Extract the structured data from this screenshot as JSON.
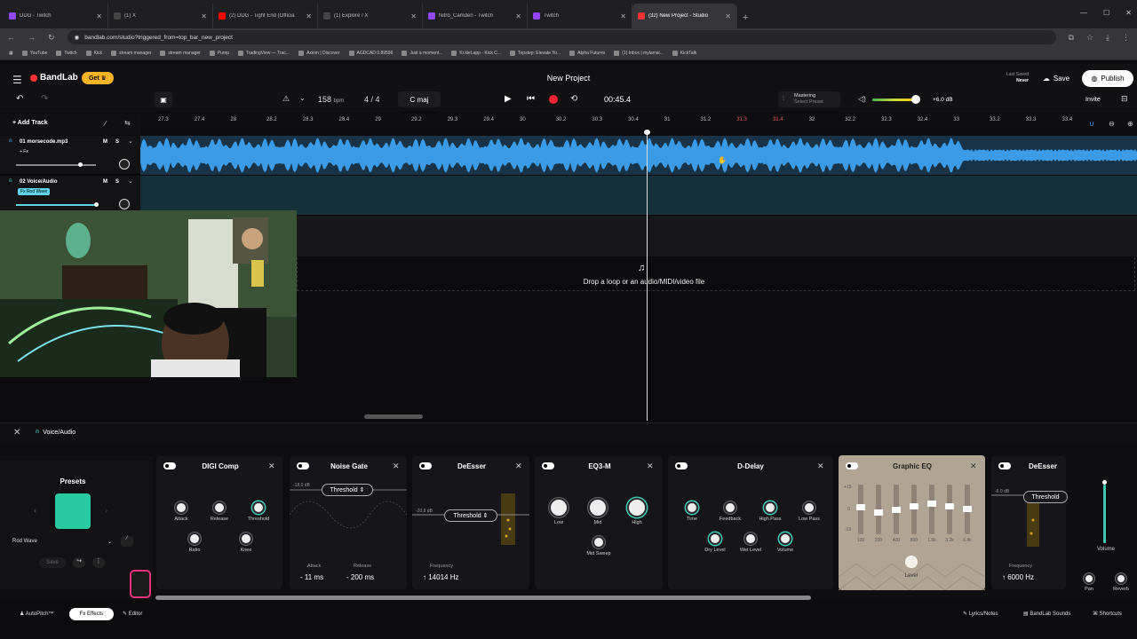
{
  "browser": {
    "tabs": [
      {
        "label": "DDG - Twitch",
        "color": "#9146ff"
      },
      {
        "label": "(1) X",
        "color": "#444444"
      },
      {
        "label": "(2) DDG - Tight End (Officia",
        "color": "#ff0000"
      },
      {
        "label": "(1) Explore / X",
        "color": "#444444"
      },
      {
        "label": "Nitro_Camden - Twitch",
        "color": "#9146ff"
      },
      {
        "label": "Twitch",
        "color": "#9146ff"
      },
      {
        "label": "(32) New Project - Studio",
        "color": "#f33333"
      }
    ],
    "url": "bandlab.com/studio?triggered_from=top_bar_new_project",
    "bookmarks": [
      "YouTube",
      "Twitch",
      "Kick",
      "stream manager",
      "stream manager",
      "Pump",
      "TradingView — Trac...",
      "Axiom | Discover",
      "AGDCAD 0.89596",
      "Just a moment...",
      "Kr.kleLapp - Kick C...",
      "Topstep: Elevate Yo...",
      "Alpha Futures",
      "(1) Inbox | mylamai...",
      "KickTalk"
    ]
  },
  "app": {
    "logo": "BandLab",
    "get_label": "Get",
    "project_title": "New Project",
    "last_saved_label": "Last Saved",
    "last_saved_value": "Never",
    "save_label": "Save",
    "publish_label": "Publish",
    "invite_label": "Invite"
  },
  "transport": {
    "bpm_value": "158",
    "bpm_unit": "bpm",
    "time_sig": "4 / 4",
    "key": "C maj",
    "time": "00:45.4",
    "mastering_label": "Mastering",
    "mastering_preset": "Select Preset",
    "gain": "+6.0 dB"
  },
  "ruler": [
    "27.3",
    "27.4",
    "28",
    "28.2",
    "28.3",
    "28.4",
    "29",
    "29.2",
    "29.3",
    "29.4",
    "30",
    "30.2",
    "30.3",
    "30.4",
    "31",
    "31.2",
    "31.3",
    "31.4",
    "32",
    "32.2",
    "32.3",
    "32.4",
    "33",
    "33.2",
    "33.3",
    "33.4"
  ],
  "tracks": {
    "add_label": "Add Track",
    "items": [
      {
        "number": "01",
        "name": "morsecode.mp3",
        "fx": "+ Fx"
      },
      {
        "number": "02",
        "name": "Voice/Audio",
        "fx": "Fx Rod Wave"
      }
    ],
    "mute": "M",
    "solo": "S"
  },
  "drop_text": "Drop a loop or an audio/MIDI/video file",
  "panel": {
    "title": "Voice/Audio",
    "presets_title": "Presets",
    "preset_name": "Rod Wave",
    "save_label": "Save"
  },
  "effects": {
    "digi": {
      "title": "DIGI Comp",
      "knobs": [
        "Attack",
        "Release",
        "Threshold",
        "Ratio",
        "Knee"
      ]
    },
    "gate": {
      "title": "Noise Gate",
      "db": "-18.0 dB",
      "pill": "Threshold",
      "attack_label": "Attack",
      "attack_val": "11 ms",
      "release_label": "Release",
      "release_val": "200 ms"
    },
    "deesser": {
      "title": "DeEsser",
      "db": "-20.8 dB",
      "pill": "Threshold",
      "freq_label": "Frequency",
      "freq_val": "14014 Hz"
    },
    "eq3": {
      "title": "EQ3-M",
      "knobs": [
        "Low",
        "Mid",
        "High",
        "Mid Sweep"
      ]
    },
    "delay": {
      "title": "D-Delay",
      "knobs": [
        "Time",
        "Feedback",
        "High Pass",
        "Low Pass",
        "Dry Level",
        "Wet Level",
        "Volume"
      ]
    },
    "geq": {
      "title": "Graphic EQ",
      "scale": [
        "+15",
        "0",
        "-15"
      ],
      "bands": [
        "100",
        "200",
        "400",
        "800",
        "1.6k",
        "3.2k",
        "6.4k"
      ],
      "levels": [
        0.45,
        0.55,
        0.5,
        0.42,
        0.38,
        0.42,
        0.48
      ],
      "level_label": "Level"
    },
    "deesser2": {
      "title": "DeEsser",
      "db": "-6.0 dB",
      "pill": "Threshold",
      "freq_label": "Frequency",
      "freq_val": "6000 Hz"
    }
  },
  "right_controls": {
    "volume": "Volume",
    "pan": "Pan",
    "reverb": "Reverb"
  },
  "footer": {
    "autopitch": "AutoPitch™",
    "effects": "Fx Effects",
    "editor": "Editor",
    "lyrics": "Lyrics/Notes",
    "sounds": "BandLab Sounds",
    "shortcuts": "Shortcuts"
  }
}
